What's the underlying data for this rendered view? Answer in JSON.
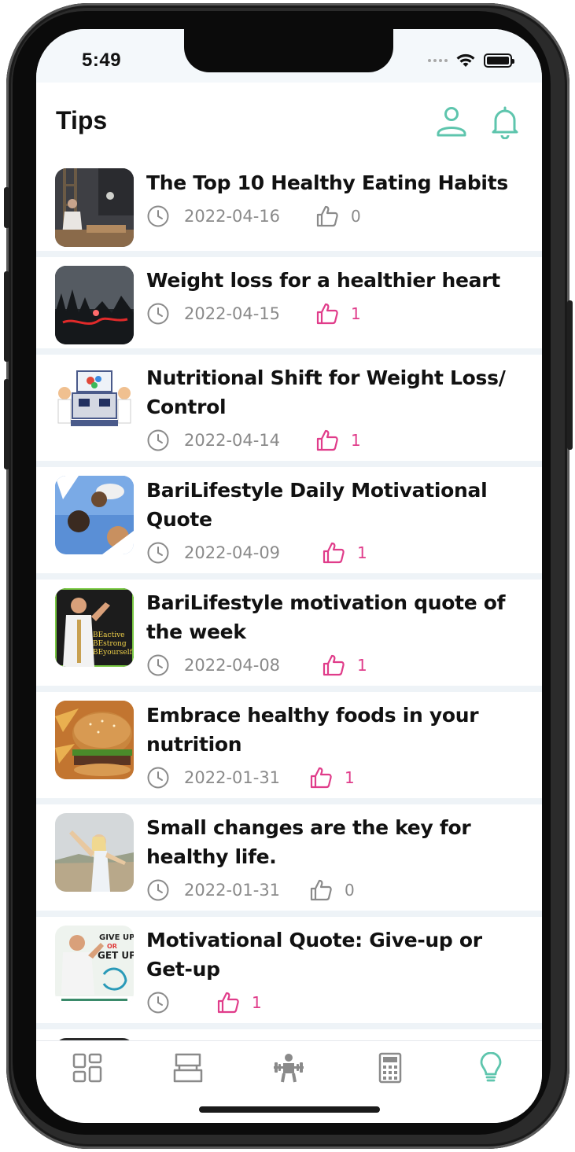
{
  "status_bar": {
    "time": "5:49"
  },
  "header": {
    "title": "Tips"
  },
  "colors": {
    "accent": "#5ec5ad",
    "like_active": "#e03c8a",
    "like_inactive": "#8a8a8a",
    "text_muted": "#8a8a8a"
  },
  "tips": [
    {
      "title": "The Top 10 Healthy Eating Habits",
      "date": "2022-04-16",
      "likes": "0",
      "liked": false
    },
    {
      "title": "Weight loss for a healthier heart",
      "date": "2022-04-15",
      "likes": "1",
      "liked": true
    },
    {
      "title": "Nutritional Shift for Weight Loss/ Control",
      "date": "2022-04-14",
      "likes": "1",
      "liked": true
    },
    {
      "title": "BariLifestyle Daily Motivational Quote",
      "date": "2022-04-09",
      "likes": "1",
      "liked": true
    },
    {
      "title": "BariLifestyle motivation quote of the week",
      "date": "2022-04-08",
      "likes": "1",
      "liked": true
    },
    {
      "title": "Embrace healthy foods in your nutrition",
      "date": "2022-01-31",
      "likes": "1",
      "liked": true
    },
    {
      "title": "Small changes are the key for healthy life.",
      "date": "2022-01-31",
      "likes": "0",
      "liked": false
    },
    {
      "title": "Motivational Quote: Give-up or Get-up",
      "date": "",
      "likes": "1",
      "liked": true
    }
  ],
  "thumb_texts": {
    "t5": [
      "BEactive",
      "BEstrong",
      "BEyourself"
    ],
    "t8": [
      "GIVE UP",
      "OR",
      "GET UP"
    ]
  },
  "bottom_nav": [
    {
      "icon": "dashboard-icon",
      "active": false
    },
    {
      "icon": "cards-icon",
      "active": false
    },
    {
      "icon": "workout-icon",
      "active": false
    },
    {
      "icon": "calculator-icon",
      "active": false
    },
    {
      "icon": "lightbulb-icon",
      "active": true
    }
  ]
}
